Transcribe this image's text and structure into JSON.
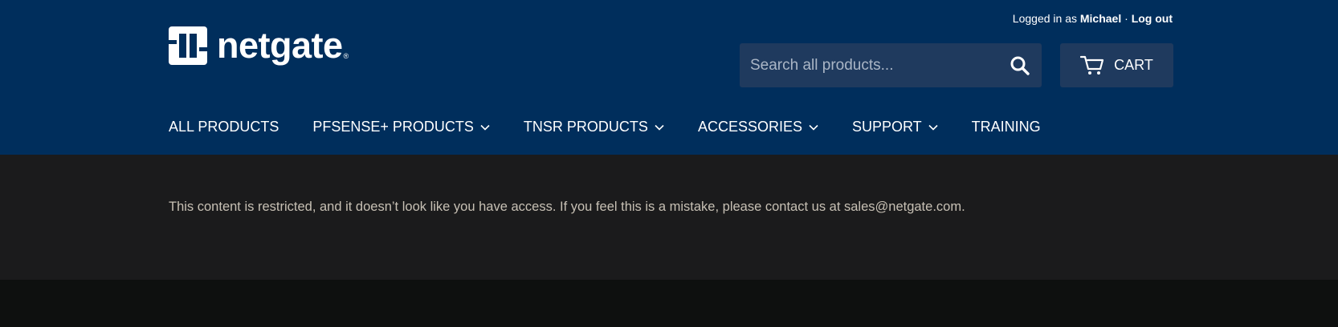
{
  "account": {
    "prefix": "Logged in as",
    "username": "Michael",
    "separator": "·",
    "logout": "Log out"
  },
  "brand": {
    "name": "netgate",
    "registered": "®",
    "icon": "netgate-logo-icon"
  },
  "search": {
    "placeholder": "Search all products...",
    "value": "",
    "icon": "search-icon"
  },
  "cart": {
    "label": "CART",
    "icon": "cart-icon"
  },
  "nav": {
    "items": [
      {
        "label": "ALL PRODUCTS",
        "dropdown": false
      },
      {
        "label": "PFSENSE+ PRODUCTS",
        "dropdown": true
      },
      {
        "label": "TNSR PRODUCTS",
        "dropdown": true
      },
      {
        "label": "ACCESSORIES",
        "dropdown": true
      },
      {
        "label": "SUPPORT",
        "dropdown": true
      },
      {
        "label": "TRAINING",
        "dropdown": false
      }
    ]
  },
  "main": {
    "message": "This content is restricted, and it doesn’t look like you have access. If you feel this is a mistake, please contact us at sales@netgate.com."
  },
  "colors": {
    "header_bg": "#002e5c",
    "control_bg": "#1f3a5e",
    "content_bg": "#1b1b1c",
    "footer_bg": "#0e100f",
    "message_text": "#c7c0b4"
  }
}
